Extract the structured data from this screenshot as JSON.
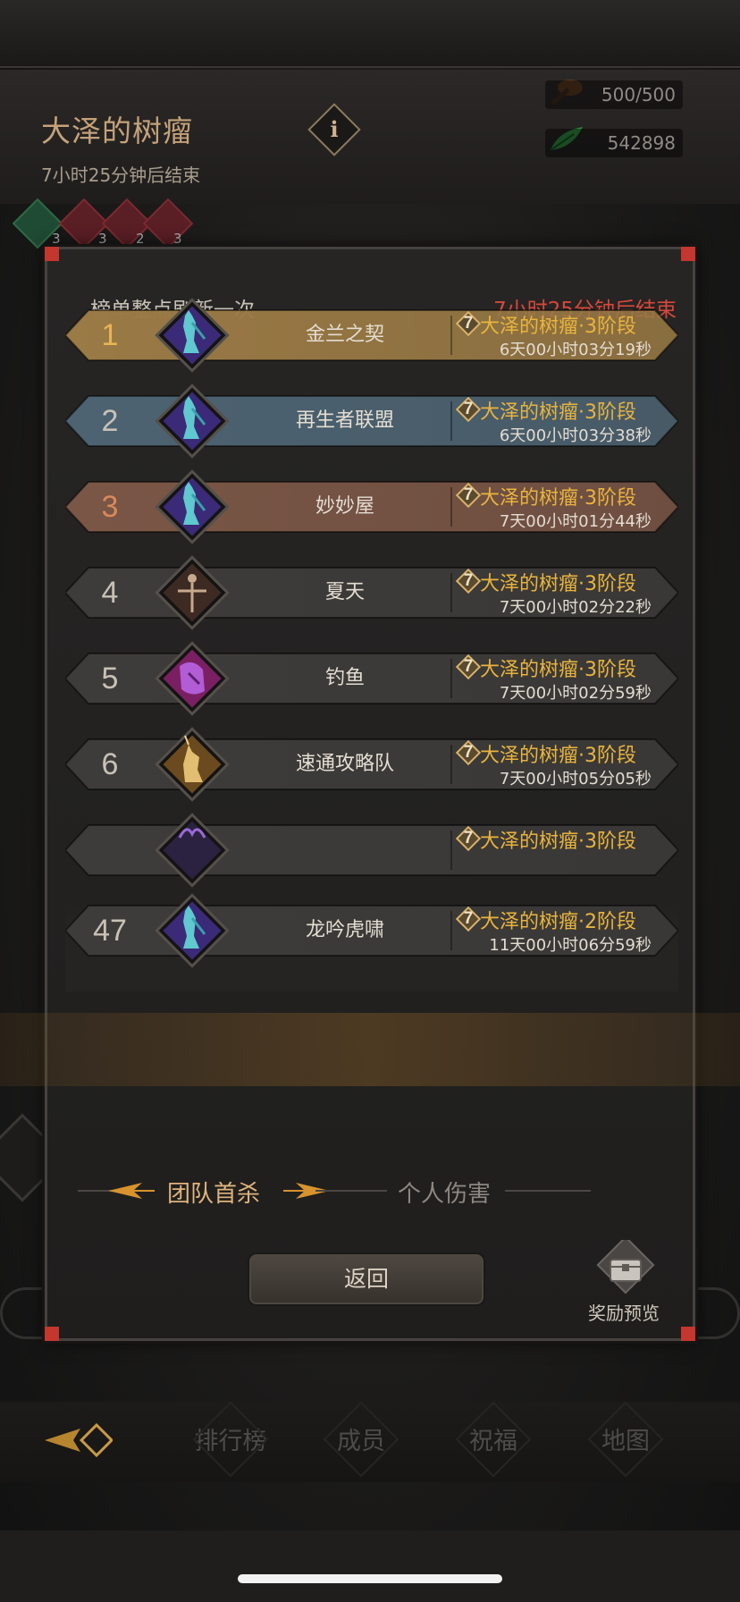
{
  "header": {
    "title": "大泽的树瘤",
    "subtitle": "7小时25分钟后结束",
    "info_label": "i",
    "stamina": "500/500",
    "currency": "542898",
    "status_counts": [
      "3",
      "3",
      "2",
      "3"
    ]
  },
  "panel": {
    "refresh_hint": "榜单整点刷新一次",
    "timer": "7小时25分钟后结束",
    "rows": [
      {
        "rank": "1",
        "guild": "金兰之契",
        "stage_num": "7",
        "stage": "大泽的树瘤·3阶段",
        "time": "6天00小时03分19秒"
      },
      {
        "rank": "2",
        "guild": "再生者联盟",
        "stage_num": "7",
        "stage": "大泽的树瘤·3阶段",
        "time": "6天00小时03分38秒"
      },
      {
        "rank": "3",
        "guild": "妙妙屋",
        "stage_num": "7",
        "stage": "大泽的树瘤·3阶段",
        "time": "7天00小时01分44秒"
      },
      {
        "rank": "4",
        "guild": "夏天",
        "stage_num": "7",
        "stage": "大泽的树瘤·3阶段",
        "time": "7天00小时02分22秒"
      },
      {
        "rank": "5",
        "guild": "钓鱼",
        "stage_num": "7",
        "stage": "大泽的树瘤·3阶段",
        "time": "7天00小时02分59秒"
      },
      {
        "rank": "6",
        "guild": "速通攻略队",
        "stage_num": "7",
        "stage": "大泽的树瘤·3阶段",
        "time": "7天00小时05分05秒"
      },
      {
        "rank": "",
        "guild": "",
        "stage_num": "7",
        "stage": "大泽的树瘤·3阶段",
        "time": ""
      }
    ],
    "my_row": {
      "rank": "47",
      "guild": "龙吟虎啸",
      "stage_num": "7",
      "stage": "大泽的树瘤·2阶段",
      "time": "11天00小时06分59秒"
    },
    "tabs": {
      "team": "团队首杀",
      "personal": "个人伤害"
    },
    "return_label": "返回",
    "reward_label": "奖励预览"
  },
  "nav": {
    "items": [
      "排行榜",
      "成员",
      "祝福",
      "地图"
    ]
  },
  "colors": {
    "gold": "#e9b43d",
    "timer_red": "#d9473b",
    "rank1": "#9a7a45",
    "rank2": "#4d6372",
    "rank3": "#7a5646",
    "rank_default": "#3e3c3a"
  },
  "icons": {
    "guild_emblems": [
      "lion-warrior-blue",
      "lion-warrior-blue",
      "lion-warrior-blue",
      "crossed-weapons-brown",
      "purple-demon",
      "golden-unicorn",
      "purple-horned",
      "lion-warrior-blue"
    ]
  }
}
